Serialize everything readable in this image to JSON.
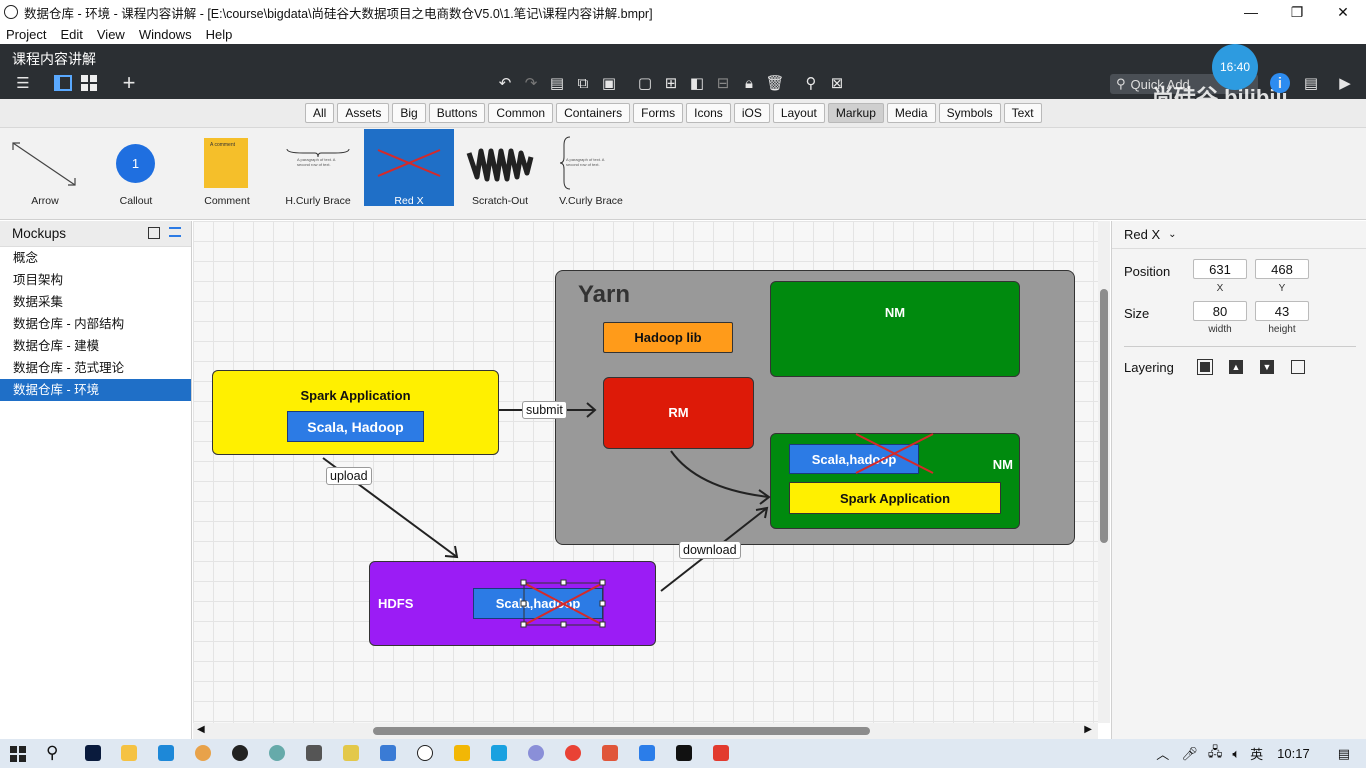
{
  "window": {
    "title": "数据仓库 - 环境 - 课程内容讲解 - [E:\\course\\bigdata\\尚硅谷大数据项目之电商数仓V5.0\\1.笔记\\课程内容讲解.bmpr]",
    "controls": [
      "—",
      "❐",
      "✕"
    ]
  },
  "menu": [
    "Project",
    "Edit",
    "View",
    "Windows",
    "Help"
  ],
  "document_title": "课程内容讲解",
  "quick_add": {
    "placeholder": "Quick Add"
  },
  "overlay": {
    "watermark": "尚硅谷",
    "clock": "16:40"
  },
  "filters": {
    "tabs": [
      "All",
      "Assets",
      "Big",
      "Buttons",
      "Common",
      "Containers",
      "Forms",
      "Icons",
      "iOS",
      "Layout",
      "Markup",
      "Media",
      "Symbols",
      "Text"
    ],
    "active": "Markup"
  },
  "library": {
    "items": [
      {
        "label": "Arrow",
        "icon": "arrow-icon"
      },
      {
        "label": "Callout",
        "icon": "callout-icon",
        "callout_text": "1"
      },
      {
        "label": "Comment",
        "icon": "comment-icon",
        "comment_text": "A comment"
      },
      {
        "label": "H.Curly Brace",
        "icon": "h-curly-brace-icon",
        "preview_text": "A paragraph of text. A second row of text."
      },
      {
        "label": "Red X",
        "icon": "red-x-icon"
      },
      {
        "label": "Scratch-Out",
        "icon": "scratch-out-icon"
      },
      {
        "label": "V.Curly Brace",
        "icon": "v-curly-brace-icon",
        "preview_text": "A paragraph of text. A second row of text."
      }
    ],
    "selected": "Red X"
  },
  "mockups": {
    "header": "Mockups",
    "items": [
      "概念",
      "项目架构",
      "数据采集",
      "数据仓库 - 内部结构",
      "数据仓库 - 建模",
      "数据仓库 - 范式理论",
      "数据仓库 - 环境"
    ],
    "selected": "数据仓库 - 环境"
  },
  "diagram": {
    "yarn_label": "Yarn",
    "hadoop_lib": "Hadoop lib",
    "nm_top": "NM",
    "rm": "RM",
    "nm_bottom": "NM",
    "nm_scala": "Scala,hadoop",
    "nm_spark": "Spark Application",
    "spark_app": "Spark Application",
    "spark_scala": "Scala, Hadoop",
    "hdfs": "HDFS",
    "hdfs_scala": "Scala,hadoop",
    "submit": "submit",
    "upload": "upload",
    "download": "download",
    "colors": {
      "yarn": "#999999",
      "nm": "#008a0e",
      "rm": "#dd1a08",
      "hadoop_lib": "#ff9b1a",
      "spark": "#fff000",
      "hdfs": "#9b1cf5",
      "blue_button": "#2c7be5",
      "red_x": "#d42a2a"
    }
  },
  "properties": {
    "selection": "Red X",
    "position_label": "Position",
    "x": "631",
    "y": "468",
    "x_label": "X",
    "y_label": "Y",
    "size_label": "Size",
    "width": "80",
    "height": "43",
    "width_label": "width",
    "height_label": "height",
    "layering_label": "Layering"
  },
  "taskbar": {
    "ime": "英",
    "clock": "10:17"
  }
}
